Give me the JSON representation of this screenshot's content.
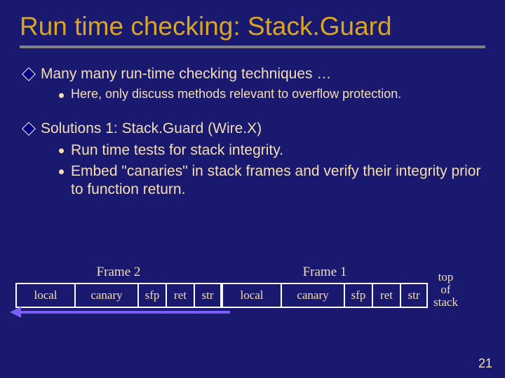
{
  "title": "Run time checking: Stack.Guard",
  "bullets": {
    "b1": "Many many run-time checking techniques …",
    "b1_1": "Here, only discuss methods relevant to overflow protection.",
    "b2": "Solutions 1:  Stack.Guard  (Wire.X)",
    "b2_1": "Run time tests for stack integrity.",
    "b2_2": "Embed \"canaries\" in stack frames and verify their integrity prior to function return."
  },
  "diagram": {
    "frame2_label": "Frame 2",
    "frame1_label": "Frame 1",
    "cells": {
      "local": "local",
      "canary": "canary",
      "sfp": "sfp",
      "ret": "ret",
      "str": "str"
    },
    "top_of_stack_1": "top",
    "top_of_stack_2": "of",
    "top_of_stack_3": "stack"
  },
  "page_number": "21"
}
